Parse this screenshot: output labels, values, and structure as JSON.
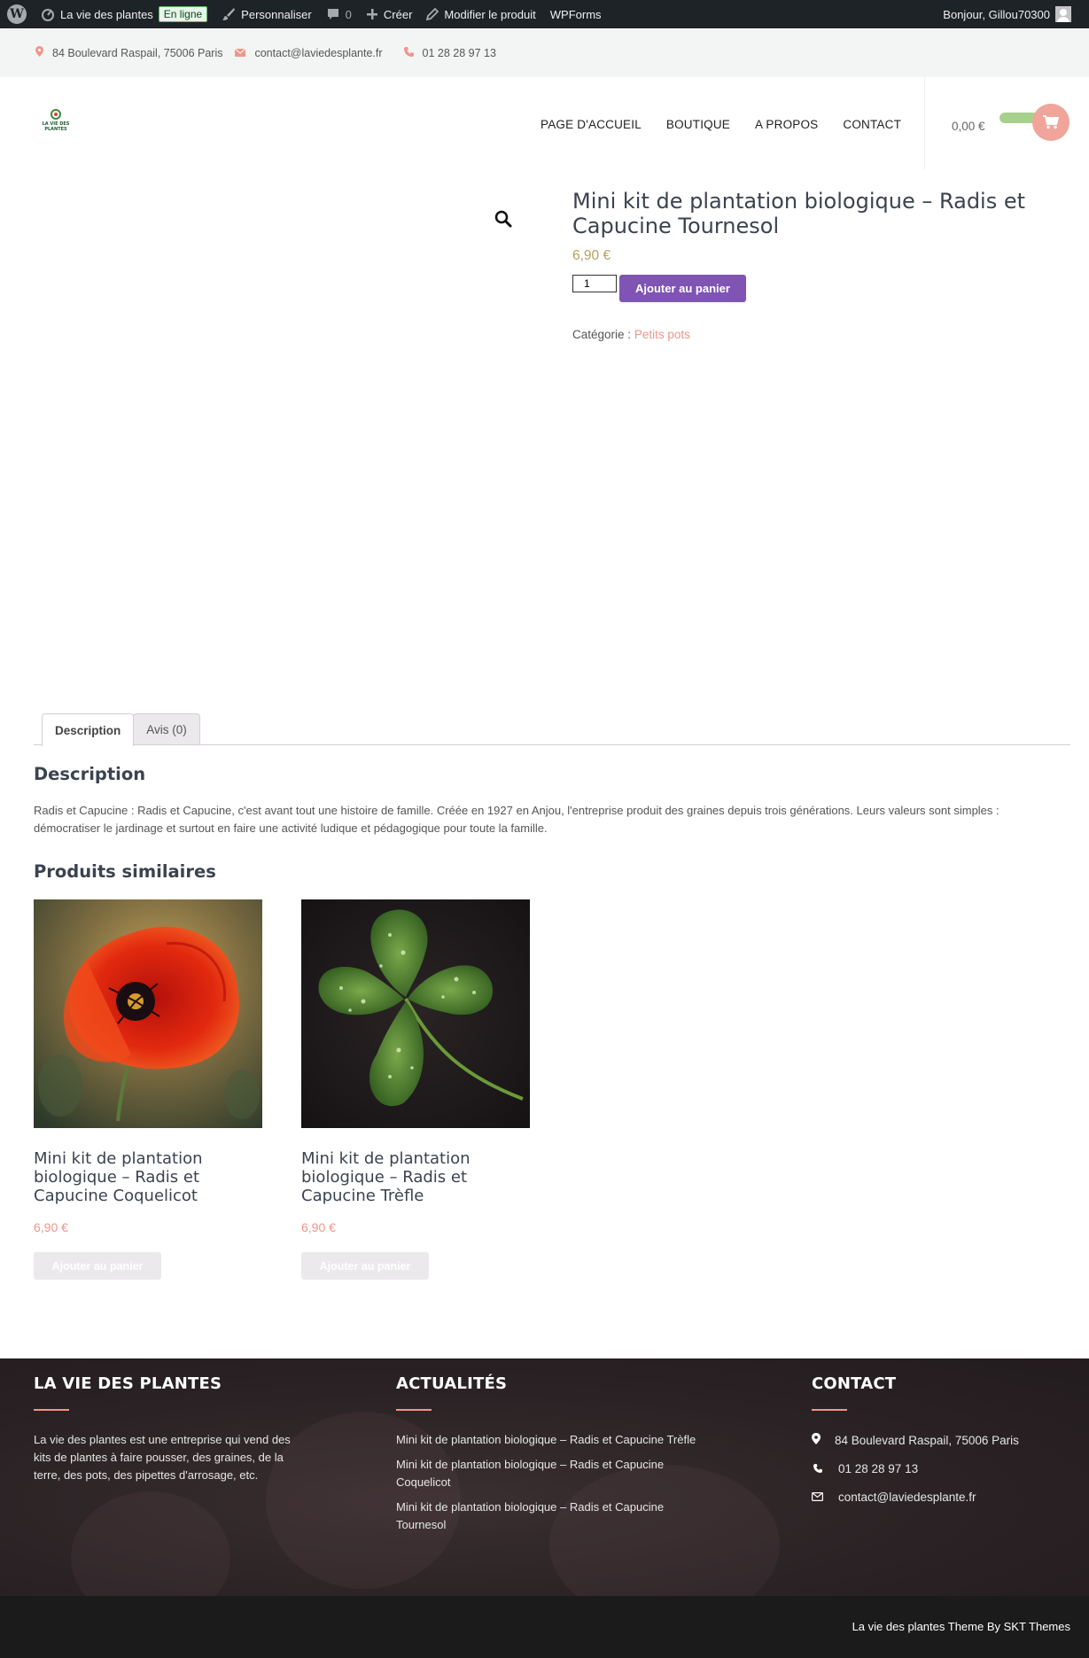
{
  "admin_bar": {
    "site_name": "La vie des plantes",
    "status_badge": "En ligne",
    "customize": "Personnaliser",
    "comments_count": "0",
    "create": "Créer",
    "edit_product": "Modifier le produit",
    "wpforms": "WPForms",
    "greeting": "Bonjour, Gillou70300"
  },
  "topbar": {
    "address": "84 Boulevard Raspail, 75006 Paris",
    "email": "contact@laviedesplante.fr",
    "phone": "01 28 28 97 13"
  },
  "header": {
    "logo_text": "LA VIE DES PLANTES",
    "nav": [
      "PAGE D'ACCUEIL",
      "BOUTIQUE",
      "A PROPOS",
      "CONTACT"
    ],
    "cart_total": "0,00 €"
  },
  "product": {
    "title": "Mini kit de plantation biologique – Radis et Capucine Tournesol",
    "price": "6,90 €",
    "quantity": "1",
    "add_to_cart": "Ajouter au panier",
    "category_label": "Catégorie :",
    "category_value": "Petits pots"
  },
  "tabs": {
    "description": "Description",
    "reviews": "Avis (0)"
  },
  "description": {
    "heading": "Description",
    "text": "Radis et Capucine : Radis et Capucine, c'est avant tout une histoire de famille. Créée en 1927 en Anjou, l'entreprise produit des graines depuis trois générations. Leurs valeurs sont simples : démocratiser le jardinage et surtout en faire une activité ludique et pédagogique pour toute la famille."
  },
  "related": {
    "heading": "Produits similaires",
    "items": [
      {
        "title": "Mini kit de plantation biologique – Radis et Capucine Coquelicot",
        "price": "6,90 €",
        "button": "Ajouter au panier"
      },
      {
        "title": "Mini kit de plantation biologique – Radis et Capucine Trèfle",
        "price": "6,90 €",
        "button": "Ajouter au panier"
      }
    ]
  },
  "footer": {
    "about": {
      "heading": "LA VIE DES PLANTES",
      "text": "La vie des plantes est une entreprise qui vend des kits de plantes à faire pousser, des graines, de la terre, des pots, des pipettes d'arrosage, etc."
    },
    "news": {
      "heading": "ACTUALITÉS",
      "items": [
        "Mini kit de plantation biologique – Radis et Capucine Trèfle",
        "Mini kit de plantation biologique – Radis et Capucine Coquelicot",
        "Mini kit de plantation biologique – Radis et Capucine Tournesol"
      ]
    },
    "contact": {
      "heading": "CONTACT",
      "address": "84 Boulevard Raspail, 75006 Paris",
      "phone": "01 28 28 97 13",
      "email": "contact@laviedesplante.fr"
    },
    "credit": "La vie des plantes Theme By SKT Themes"
  },
  "colors": {
    "admin_bar_bg": "#1d2327",
    "accent_salmon": "#f0958a",
    "button_purple": "#7f54b3",
    "price_gold": "#b6a35c",
    "cart_green": "#a8d08d"
  }
}
